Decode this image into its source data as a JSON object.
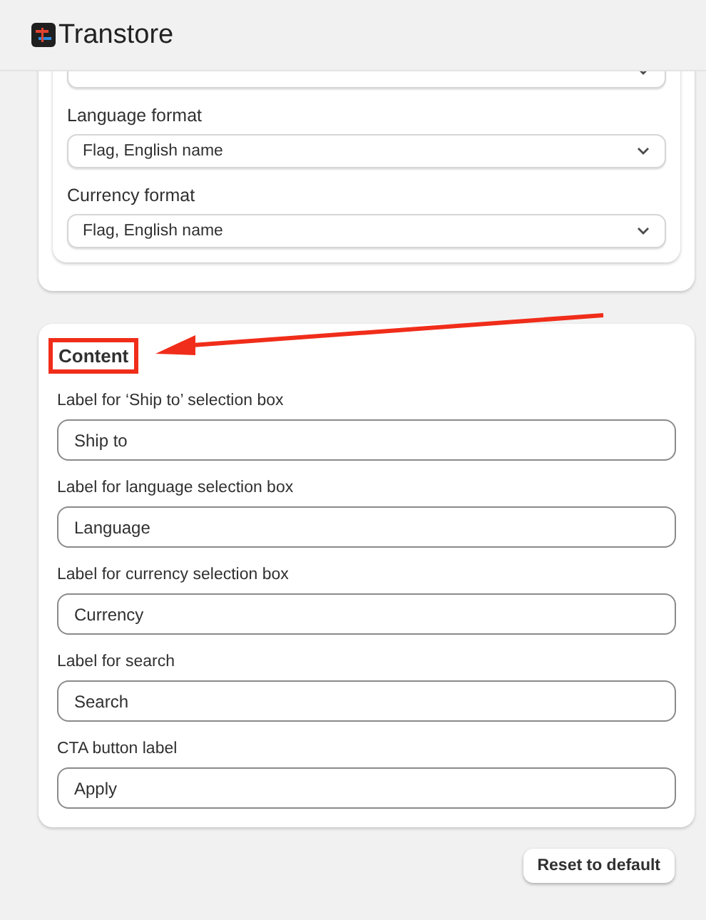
{
  "header": {
    "title": "Transtore"
  },
  "format_card": {
    "selects": [
      {
        "label": "Language format",
        "value": "Flag, English name"
      },
      {
        "label": "Currency format",
        "value": "Flag, English name"
      }
    ]
  },
  "content_card": {
    "title": "Content",
    "highlighted": true,
    "fields": [
      {
        "label": "Label for ‘Ship to’ selection box",
        "value": "Ship to"
      },
      {
        "label": "Label for language selection box",
        "value": "Language"
      },
      {
        "label": "Label for currency selection box",
        "value": "Currency"
      },
      {
        "label": "Label for search",
        "value": "Search"
      },
      {
        "label": "CTA button label",
        "value": "Apply"
      }
    ]
  },
  "buttons": [
    "Reset to default"
  ]
}
